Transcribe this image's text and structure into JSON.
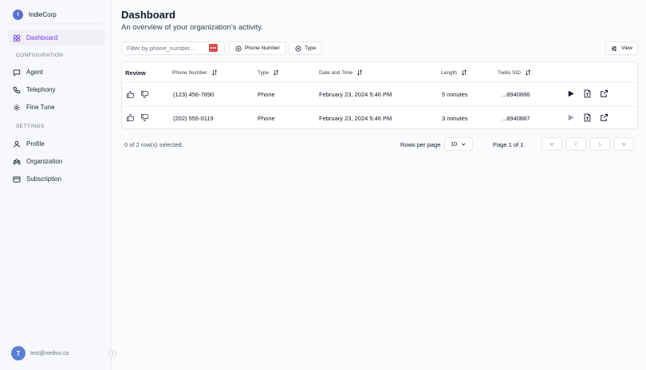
{
  "brand": {
    "initial": "I",
    "name": "IndieCorp"
  },
  "sidebar": {
    "items": [
      {
        "label": "Dashboard",
        "icon": "grid-icon"
      },
      {
        "label": "Agent",
        "icon": "chat-icon"
      },
      {
        "label": "Telephony",
        "icon": "phone-icon"
      },
      {
        "label": "Fine Tune",
        "icon": "gear-icon"
      },
      {
        "label": "Profile",
        "icon": "user-icon"
      },
      {
        "label": "Organization",
        "icon": "organization-icon"
      },
      {
        "label": "Subscription",
        "icon": "card-icon"
      }
    ],
    "sections": {
      "configuration": "CONFIGURATION",
      "settings": "SETTINGS"
    },
    "user": {
      "initial": "T",
      "email": "test@nedivo.co"
    }
  },
  "header": {
    "title": "Dashboard",
    "subtitle": "An overview of your organization's activity."
  },
  "toolbar": {
    "filter_placeholder": "Filter by phone_number...",
    "chips": [
      "Phone Number",
      "Type"
    ],
    "view_label": "View"
  },
  "table": {
    "columns": [
      "Review",
      "Phone Number",
      "Type",
      "Date and Time",
      "Length",
      "Twilio SID"
    ],
    "rows": [
      {
        "phone": "(123) 456-7890",
        "type": "Phone",
        "datetime": "February 23, 2024 5:46 PM",
        "length": "5 minutes",
        "sid": "...8940886"
      },
      {
        "phone": "(202) 555-0119",
        "type": "Phone",
        "datetime": "February 23, 2024 5:46 PM",
        "length": "3 minutes",
        "sid": "...8940887"
      }
    ]
  },
  "footer": {
    "selected": "0 of 2 row(s) selected.",
    "rows_per_page_label": "Rows per page",
    "rows_per_page_value": "10",
    "page_label": "Page 1 of 1"
  },
  "colors": {
    "accent": "#7c3aed",
    "avatar": "#5b7fd8",
    "badge": "#dc4a4a"
  }
}
